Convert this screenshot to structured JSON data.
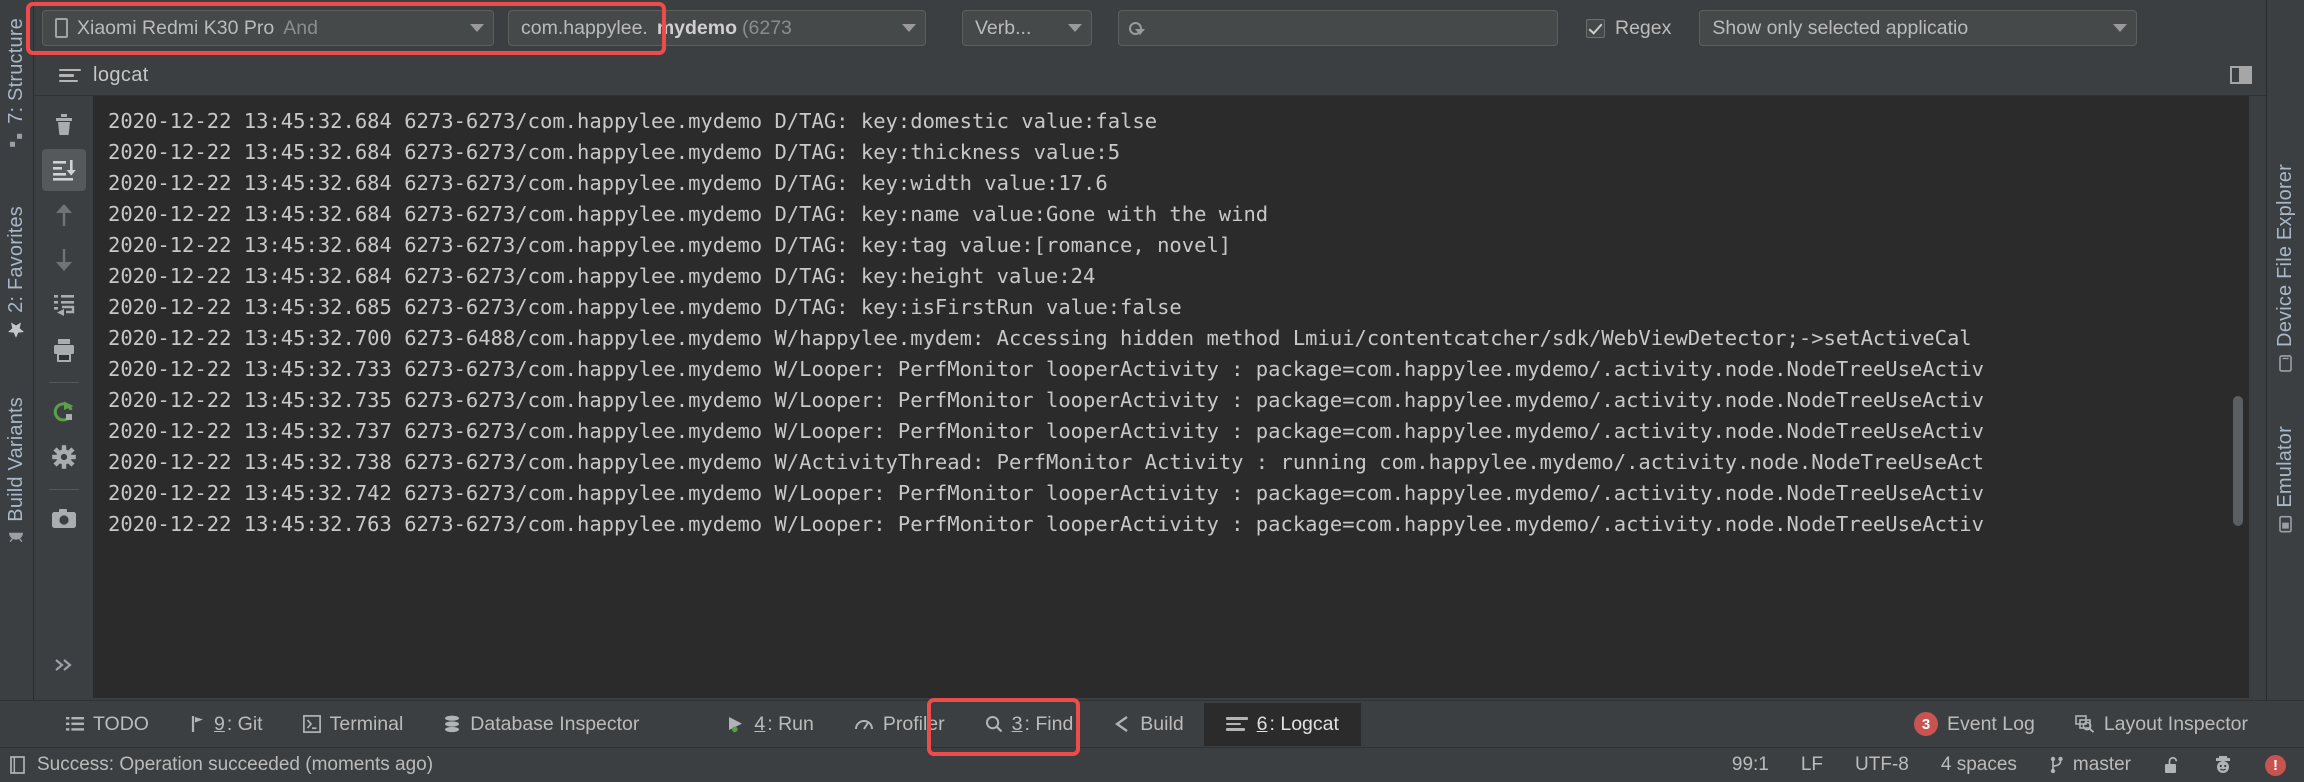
{
  "window": {
    "accent_red": "#ef4b4b",
    "bg": "#3c3f41",
    "log_bg": "#2b2b2b"
  },
  "left_strip": {
    "tabs": [
      {
        "label": "7: Structure",
        "icon": "structure-icon"
      },
      {
        "label": "2: Favorites",
        "icon": "star-icon"
      },
      {
        "label": "Build Variants",
        "icon": "android-icon"
      }
    ]
  },
  "right_strip": {
    "tabs": [
      {
        "label": "Device File Explorer",
        "icon": "device-file-explorer-icon"
      },
      {
        "label": "Emulator",
        "icon": "emulator-icon"
      }
    ]
  },
  "toolbar": {
    "device": "Xiaomi Redmi K30 Pro",
    "device_suffix": "And",
    "process_prefix": "com.happylee.",
    "process_bold": "mydemo",
    "process_pid": " (6273",
    "log_level": "Verb...",
    "search_value": "",
    "search_placeholder": "",
    "regex_label": "Regex",
    "regex_checked": true,
    "scope": "Show only selected applicatio"
  },
  "tab": {
    "title": "logcat"
  },
  "gutter": {
    "buttons": [
      {
        "name": "clear-logcat-button",
        "icon": "trash-icon",
        "selected": false
      },
      {
        "name": "scroll-to-end-button",
        "icon": "scroll-to-end-icon",
        "selected": true
      },
      {
        "name": "up-the-stack-button",
        "icon": "arrow-up-icon",
        "selected": false
      },
      {
        "name": "down-the-stack-button",
        "icon": "arrow-down-icon",
        "selected": false
      },
      {
        "name": "soft-wraps-button",
        "icon": "soft-wrap-icon",
        "selected": false
      },
      {
        "name": "print-button",
        "icon": "printer-icon",
        "selected": false
      },
      {
        "name": "restart-logcat-button",
        "icon": "restart-icon",
        "selected": false
      },
      {
        "name": "logcat-settings-button",
        "icon": "gear-icon",
        "selected": false
      },
      {
        "name": "screenshot-button",
        "icon": "camera-icon",
        "selected": false
      },
      {
        "name": "expand-actions-button",
        "icon": "chevrons-right-icon",
        "selected": false
      }
    ]
  },
  "log": {
    "lines": [
      "2020-12-22 13:45:32.684 6273-6273/com.happylee.mydemo D/TAG: key:domestic value:false",
      "2020-12-22 13:45:32.684 6273-6273/com.happylee.mydemo D/TAG: key:thickness value:5",
      "2020-12-22 13:45:32.684 6273-6273/com.happylee.mydemo D/TAG: key:width value:17.6",
      "2020-12-22 13:45:32.684 6273-6273/com.happylee.mydemo D/TAG: key:name value:Gone with the wind",
      "2020-12-22 13:45:32.684 6273-6273/com.happylee.mydemo D/TAG: key:tag value:[romance, novel]",
      "2020-12-22 13:45:32.684 6273-6273/com.happylee.mydemo D/TAG: key:height value:24",
      "2020-12-22 13:45:32.685 6273-6273/com.happylee.mydemo D/TAG: key:isFirstRun value:false",
      "2020-12-22 13:45:32.700 6273-6488/com.happylee.mydemo W/happylee.mydem: Accessing hidden method Lmiui/contentcatcher/sdk/WebViewDetector;->setActiveCal",
      "2020-12-22 13:45:32.733 6273-6273/com.happylee.mydemo W/Looper: PerfMonitor looperActivity : package=com.happylee.mydemo/.activity.node.NodeTreeUseActiv",
      "2020-12-22 13:45:32.735 6273-6273/com.happylee.mydemo W/Looper: PerfMonitor looperActivity : package=com.happylee.mydemo/.activity.node.NodeTreeUseActiv",
      "2020-12-22 13:45:32.737 6273-6273/com.happylee.mydemo W/Looper: PerfMonitor looperActivity : package=com.happylee.mydemo/.activity.node.NodeTreeUseActiv",
      "2020-12-22 13:45:32.738 6273-6273/com.happylee.mydemo W/ActivityThread: PerfMonitor Activity : running com.happylee.mydemo/.activity.node.NodeTreeUseAct",
      "2020-12-22 13:45:32.742 6273-6273/com.happylee.mydemo W/Looper: PerfMonitor looperActivity : package=com.happylee.mydemo/.activity.node.NodeTreeUseActiv",
      "2020-12-22 13:45:32.763 6273-6273/com.happylee.mydemo W/Looper: PerfMonitor looperActivity : package=com.happylee.mydemo/.activity.node.NodeTreeUseActiv"
    ]
  },
  "bottom_bar": {
    "items": [
      {
        "label": "TODO",
        "icon": "todo-icon",
        "mnemonic": "",
        "active": false
      },
      {
        "label": ": Git",
        "icon": "git-icon",
        "mnemonic": "9",
        "active": false
      },
      {
        "label": "Terminal",
        "icon": "terminal-icon",
        "mnemonic": "",
        "active": false
      },
      {
        "label": "Database Inspector",
        "icon": "database-icon",
        "mnemonic": "",
        "active": false
      },
      {
        "label": ": Run",
        "icon": "run-icon",
        "mnemonic": "4",
        "active": false
      },
      {
        "label": "Profiler",
        "icon": "profiler-icon",
        "mnemonic": "",
        "active": false
      },
      {
        "label": ": Find",
        "icon": "find-icon",
        "mnemonic": "3",
        "active": false
      },
      {
        "label": "Build",
        "icon": "build-icon",
        "mnemonic": "",
        "active": false
      },
      {
        "label": ": Logcat",
        "icon": "logcat-icon",
        "mnemonic": "6",
        "active": true
      }
    ],
    "right_items": [
      {
        "label": "Event Log",
        "icon": "event-log-icon",
        "badge": "3"
      },
      {
        "label": "Layout Inspector",
        "icon": "layout-inspector-icon",
        "badge": ""
      }
    ]
  },
  "status_bar": {
    "message": "Success: Operation succeeded (moments ago)",
    "caret": "99:1",
    "line_separator": "LF",
    "encoding": "UTF-8",
    "indent": "4 spaces",
    "branch": "master",
    "lock_icon": "unlock-icon",
    "inspector_icon": "hector-icon",
    "error_icon": "error-icon",
    "error_glyph": "!"
  }
}
